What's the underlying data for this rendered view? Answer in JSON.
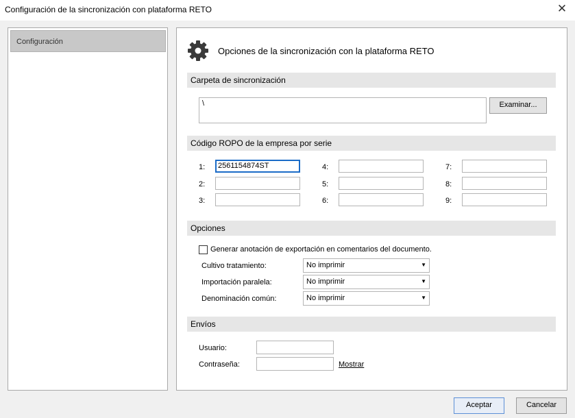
{
  "window": {
    "title": "Configuración de la sincronización con plataforma RETO",
    "close_glyph": "✕"
  },
  "sidebar": {
    "items": [
      {
        "label": "Configuración"
      }
    ]
  },
  "main": {
    "title": "Opciones de la sincronización con la plataforma RETO",
    "icon": "gear-icon"
  },
  "sync_folder": {
    "heading": "Carpeta de sincronización",
    "value": "\\",
    "browse_label": "Examinar..."
  },
  "ropo": {
    "heading": "Código ROPO de la empresa por serie",
    "entries": [
      {
        "label": "1:",
        "value": "2561154874ST"
      },
      {
        "label": "2:",
        "value": ""
      },
      {
        "label": "3:",
        "value": ""
      },
      {
        "label": "4:",
        "value": ""
      },
      {
        "label": "5:",
        "value": ""
      },
      {
        "label": "6:",
        "value": ""
      },
      {
        "label": "7:",
        "value": ""
      },
      {
        "label": "8:",
        "value": ""
      },
      {
        "label": "9:",
        "value": ""
      }
    ]
  },
  "options": {
    "heading": "Opciones",
    "checkbox_label": "Generar anotación de exportación en comentarios del documento.",
    "checkbox_checked": false,
    "selects": [
      {
        "label": "Cultivo tratamiento:",
        "value": "No imprimir"
      },
      {
        "label": "Importación paralela:",
        "value": "No imprimir"
      },
      {
        "label": "Denominación común:",
        "value": "No imprimir"
      }
    ]
  },
  "envios": {
    "heading": "Envíos",
    "user_label": "Usuario:",
    "user_value": "",
    "password_label": "Contraseña:",
    "password_value": "",
    "show_label": "Mostrar"
  },
  "footer": {
    "accept_label": "Aceptar",
    "cancel_label": "Cancelar"
  },
  "colors": {
    "focus_border": "#1a6bc7",
    "section_bg": "#e6e6e6",
    "selected_nav_bg": "#c8c8c8"
  }
}
